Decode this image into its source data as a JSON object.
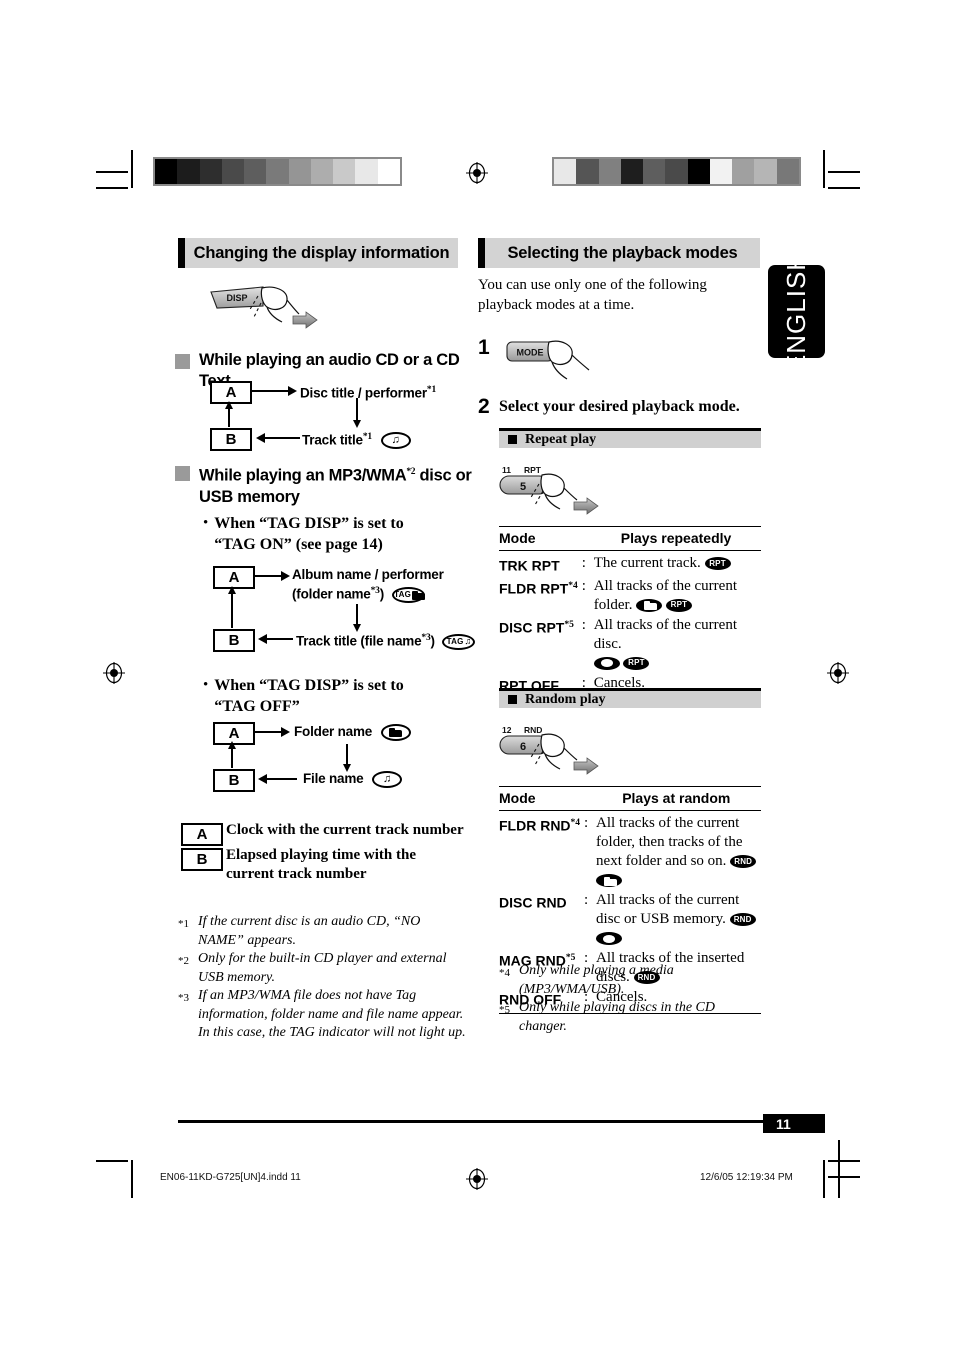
{
  "page": {
    "language_tab": "ENGLISH",
    "page_number": "11",
    "footer_file": "EN06-11KD-G725[UN]4.indd   11",
    "footer_date": "12/6/05   12:19:34 PM"
  },
  "left_column": {
    "heading": "Changing the display information",
    "disp_button_label": "DISP",
    "section_audio_cd": {
      "title": "While playing an audio CD or a CD Text",
      "box_a": "A",
      "box_b": "B",
      "label_top": "Disc title / performer",
      "label_top_fn": "*1",
      "label_bottom": "Track title",
      "label_bottom_fn": "*1",
      "bottom_icon": "music-note-icon"
    },
    "section_mp3": {
      "title_line1": "While playing an MP3/WMA",
      "title_fn": "*2",
      "title_line1_tail": " disc or",
      "title_line2": "USB memory",
      "tag_on": {
        "bullet_line1": "When “TAG DISP” is set to",
        "bullet_line2": "“TAG ON” (see page 14)",
        "box_a": "A",
        "box_b": "B",
        "label_top_line1": "Album name / performer",
        "label_top_line2": "(folder name",
        "label_top_fn": "*3",
        "label_top_line2_tail": ")",
        "label_top_icon": "tag-folder-icon",
        "label_bottom": "Track title (file name",
        "label_bottom_fn": "*3",
        "label_bottom_tail": ")",
        "label_bottom_icon": "tag-note-icon"
      },
      "tag_off": {
        "bullet_line1": "When “TAG DISP” is set to",
        "bullet_line2": "“TAG OFF”",
        "box_a": "A",
        "box_b": "B",
        "label_top": "Folder name",
        "label_top_icon": "folder-icon",
        "label_bottom": "File name",
        "label_bottom_icon": "music-note-icon"
      }
    },
    "legend": [
      {
        "key": "A",
        "text": "Clock with the current track number"
      },
      {
        "key": "B",
        "text": "Elapsed playing time with the current track number"
      }
    ],
    "footnotes": [
      {
        "mark": "*1",
        "text": "If the current disc is an audio CD, “NO NAME” appears."
      },
      {
        "mark": "*2",
        "text": "Only for the built-in CD player and external USB memory."
      },
      {
        "mark": "*3",
        "text": "If an MP3/WMA file does not have Tag information, folder name and file name appear. In this case, the TAG indicator will not light up."
      }
    ]
  },
  "right_column": {
    "heading": "Selecting the playback modes",
    "intro": "You can use only one of the following playback modes at a time.",
    "step1_number": "1",
    "step1_button_label": "MODE",
    "step2_number": "2",
    "step2_text": "Select your desired playback mode.",
    "repeat": {
      "bar_title": "Repeat play",
      "button_number": "11",
      "button_tag": "RPT",
      "button_face": "5",
      "col_mode": "Mode",
      "col_desc": "Plays repeatedly",
      "rows": [
        {
          "mode": "TRK RPT",
          "fn": "",
          "desc": "The current track.",
          "icons": [
            "rpt-icon"
          ]
        },
        {
          "mode": "FLDR RPT",
          "fn": "*4",
          "desc": "All tracks of the current folder.",
          "icons": [
            "folder-icon",
            "rpt-icon"
          ]
        },
        {
          "mode": "DISC RPT",
          "fn": "*5",
          "desc": "All tracks of the current disc.",
          "icons": [
            "disc-icon",
            "rpt-icon"
          ]
        },
        {
          "mode": "RPT OFF",
          "fn": "",
          "desc": "Cancels.",
          "icons": []
        }
      ]
    },
    "random": {
      "bar_title": "Random play",
      "button_number": "12",
      "button_tag": "RND",
      "button_face": "6",
      "col_mode": "Mode",
      "col_desc": "Plays at random",
      "rows": [
        {
          "mode": "FLDR RND",
          "fn": "*4",
          "desc": "All tracks of the current folder, then tracks of the next folder and so on.",
          "icons": [
            "rnd-icon",
            "folder-icon"
          ]
        },
        {
          "mode": "DISC RND",
          "fn": "",
          "desc": "All tracks of the current disc or USB memory.",
          "icons": [
            "rnd-icon",
            "disc-icon"
          ]
        },
        {
          "mode": "MAG RND",
          "fn": "*5",
          "desc": "All tracks of the inserted discs.",
          "icons": [
            "rnd-icon"
          ]
        },
        {
          "mode": "RND OFF",
          "fn": "",
          "desc": "Cancels.",
          "icons": []
        }
      ]
    },
    "footnotes": [
      {
        "mark": "*4",
        "text": "Only while playing a media (MP3/WMA/USB)."
      },
      {
        "mark": "*5",
        "text": "Only while playing discs in the CD changer."
      }
    ]
  },
  "colorbars": {
    "left": [
      "#000000",
      "#1c1c1c",
      "#2e2e2e",
      "#4a4a4a",
      "#5e5e5e",
      "#7a7a7a",
      "#959595",
      "#adadad",
      "#c9c9c9",
      "#e8e8e8",
      "#ffffff"
    ],
    "right": [
      "#e8e8e8",
      "#555555",
      "#808080",
      "#1e1e1e",
      "#5e5e5e",
      "#4a4a4a",
      "#000000",
      "#f2f2f2",
      "#a0a0a0",
      "#b5b5b5",
      "#787878"
    ]
  }
}
